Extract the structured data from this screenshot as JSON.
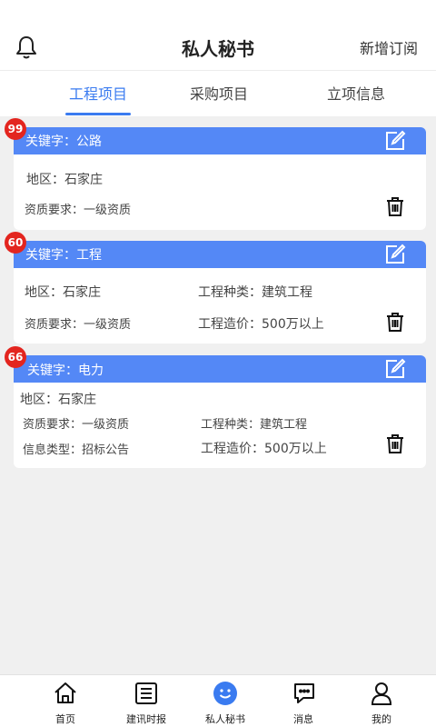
{
  "header": {
    "title": "私人秘书",
    "action": "新增订阅"
  },
  "tabs": [
    {
      "label": "工程项目"
    },
    {
      "label": "采购项目"
    },
    {
      "label": "立项信息"
    }
  ],
  "cards": [
    {
      "badge": "99",
      "keyword": "关键字：公路",
      "region": "地区：石家庄",
      "qualification": "资质要求：一级资质"
    },
    {
      "badge": "60",
      "keyword": "关键字：工程",
      "region": "地区：石家庄",
      "category": "工程种类：建筑工程",
      "qualification": "资质要求：一级资质",
      "cost": "工程造价：500万以上"
    },
    {
      "badge": "66",
      "keyword": "关键字：电力",
      "region": "地区：石家庄",
      "qualification": "资质要求：一级资质",
      "category": "工程种类：建筑工程",
      "info_type": "信息类型：招标公告",
      "cost": "工程造价：500万以上"
    }
  ],
  "nav": [
    {
      "label": "首页",
      "icon": "home-icon"
    },
    {
      "label": "建讯时报",
      "icon": "newspaper-icon"
    },
    {
      "label": "私人秘书",
      "icon": "smile-icon"
    },
    {
      "label": "消息",
      "icon": "message-icon"
    },
    {
      "label": "我的",
      "icon": "user-icon"
    }
  ],
  "colors": {
    "accent": "#3a7bf0",
    "card_header": "#5488f6",
    "badge": "#e3251f"
  }
}
